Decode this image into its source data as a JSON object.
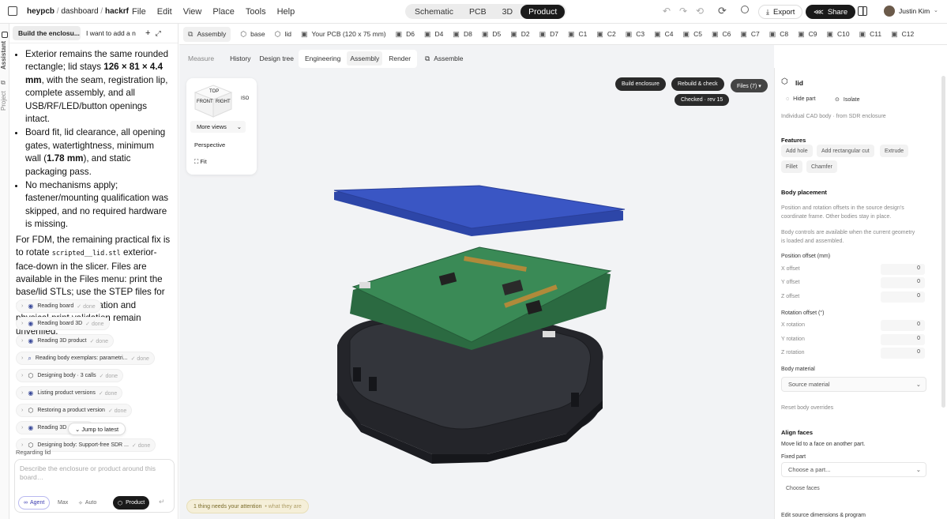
{
  "topbar": {
    "crumb_user": "heypcb",
    "crumb_mid": "dashboard",
    "crumb_project": "hackrf",
    "menu": [
      "File",
      "Edit",
      "View",
      "Place",
      "Tools",
      "Help"
    ],
    "modes": [
      "Schematic",
      "PCB",
      "3D",
      "Product"
    ],
    "active_mode": "Product",
    "export_label": "Export",
    "share_label": "Share",
    "user_name": "Justin Kim"
  },
  "rail": {
    "assistant": "Assistant",
    "project": "Project"
  },
  "chat": {
    "tabs": [
      "Build the enclosu...",
      "I want to add a n..."
    ],
    "bullet1_a": "Exterior remains the same rounded rectangle; lid stays ",
    "bullet1_dim": "126 × 81 × 4.4 mm",
    "bullet1_b": ", with the seam, registration lip, complete assembly, and all USB/RF/LED/button openings intact.",
    "bullet2_a": "Board fit, lid clearance, all opening gates, watertightness, minimum wall (",
    "bullet2_wall": "1.78 mm",
    "bullet2_b": "), and static packaging pass.",
    "bullet3": "No mechanisms apply; fastener/mounting qualification was skipped, and no required hardware is missing.",
    "para_a": "For FDM, the remaining practical fix is to rotate ",
    "para_code": "scripted__lid.stl",
    "para_b": " exterior-face-down in the slicer. Files are available in the Files menu: print the base/lid STLs; use the STEP files for CAD. Electrical operation and physical print validation remain unverified.",
    "steps": [
      {
        "label": "Reading board",
        "status": "done",
        "icon": "eye-icon"
      },
      {
        "label": "Reading board 3D",
        "status": "done",
        "icon": "eye-icon"
      },
      {
        "label": "Reading 3D product",
        "status": "done",
        "icon": "eye-icon"
      },
      {
        "label": "Reading body exemplars: parametri...",
        "status": "done",
        "icon": "search-icon"
      },
      {
        "label": "Designing body · 3 calls",
        "status": "done",
        "icon": "cube-icon"
      },
      {
        "label": "Listing product versions",
        "status": "done",
        "icon": "eye-icon"
      },
      {
        "label": "Restoring a product version",
        "status": "done",
        "icon": "cube-icon"
      },
      {
        "label": "Reading 3D",
        "status": "done",
        "icon": "eye-icon"
      },
      {
        "label": "Designing body: Support-free SDR ...",
        "status": "done",
        "icon": "cube-icon"
      }
    ],
    "jump_label": "Jump to latest",
    "regarding": "Regarding lid",
    "composer_placeholder": "Describe the enclosure or product around this board…",
    "agent_label": "Agent",
    "max_label": "Max",
    "auto_label": "Auto",
    "product_label": "Product"
  },
  "parts_tabs": [
    "Assembly",
    "base",
    "lid",
    "Your PCB (120 x 75 mm)",
    "D6",
    "D4",
    "D8",
    "D5",
    "D2",
    "D7",
    "C1",
    "C2",
    "C3",
    "C4",
    "C5",
    "C6",
    "C7",
    "C8",
    "C9",
    "C10",
    "C11",
    "C12"
  ],
  "viewport": {
    "subtabs": [
      "Measure",
      "History",
      "Design tree",
      "Engineering",
      "Assembly",
      "Render",
      "Assemble"
    ],
    "cube": {
      "top": "TOP",
      "front": "FRONT",
      "right": "RIGHT",
      "iso": "ISO",
      "more_views": "More views",
      "perspective": "Perspective",
      "fit": "Fit"
    },
    "build_label": "Build enclosure",
    "rebuild_label": "Rebuild & check",
    "checked_label": "Checked · rev 15",
    "files_label": "Files (7) ▾",
    "attention_label": "1 thing needs your attention",
    "attention_sub": "• what they are"
  },
  "props": {
    "title": "lid",
    "hide_label": "Hide part",
    "isolate_label": "Isolate",
    "subtitle": "Individual CAD body · from SDR enclosure",
    "features_title": "Features",
    "features": [
      "Add hole",
      "Add rectangular cut",
      "Extrude",
      "Fillet",
      "Chamfer"
    ],
    "placement_title": "Body placement",
    "placement_desc1": "Position and rotation offsets in the source design's",
    "placement_desc2": "coordinate frame. Other bodies stay in place.",
    "placement_desc3": "Body controls are available when the current geometry",
    "placement_desc4": "is loaded and assembled.",
    "pos_title": "Position offset (mm)",
    "x_off": "X offset",
    "y_off": "Y offset",
    "z_off": "Z offset",
    "x_val": "0",
    "y_val": "0",
    "z_val": "0",
    "rot_title": "Rotation offset (°)",
    "x_rot": "X rotation",
    "y_rot": "Y rotation",
    "z_rot": "Z rotation",
    "xr_val": "0",
    "yr_val": "0",
    "zr_val": "0",
    "material_title": "Body material",
    "material_value": "Source material",
    "reset_label": "Reset body overrides",
    "align_title": "Align faces",
    "align_desc": "Move lid to a face on another part.",
    "fixed_part": "Fixed part",
    "choose_part": "Choose a part...",
    "choose_faces": "Choose faces",
    "edit_dims": "Edit source dimensions & program"
  },
  "colors": {
    "lid": "#3a56c4",
    "board": "#2f7a4a",
    "enclosure": "#2a2b30"
  }
}
